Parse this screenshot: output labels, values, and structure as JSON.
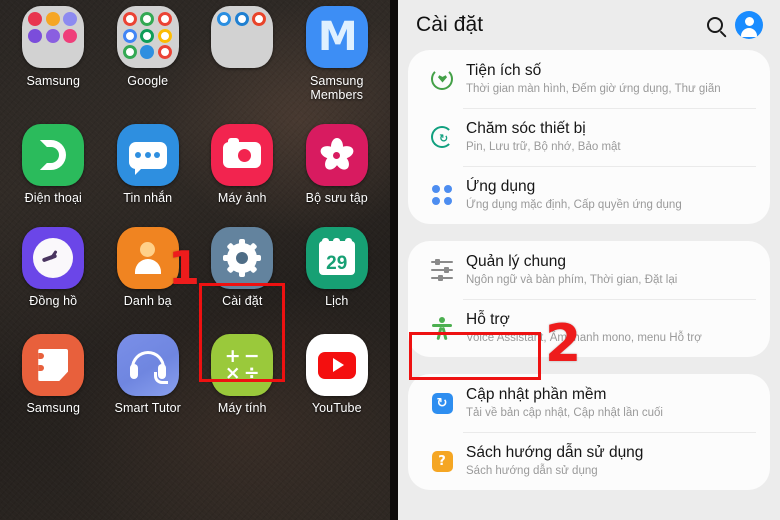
{
  "annotations": [
    {
      "label": "1",
      "name": "step-1-marker"
    },
    {
      "label": "2",
      "name": "step-2-marker"
    }
  ],
  "home": {
    "rows": [
      {
        "apps": [
          {
            "label": "Samsung",
            "icon": "samsung-folder-icon",
            "type": "folder",
            "tiles": [
              "#e8364f",
              "#f5a623",
              "#6c63e8",
              "#7b4ddb",
              "#8a5fe0",
              "#ef3f7a"
            ]
          },
          {
            "label": "Google",
            "icon": "google-folder-icon",
            "type": "folder",
            "tiles": [
              "#ffffff",
              "#ffffff",
              "#ffffff",
              "#ffffff",
              "#ffffff",
              "#ffffff",
              "#ffffff",
              "#ffffff",
              "#ffffff"
            ]
          },
          {
            "label": "",
            "icon": "microsoft-folder-icon",
            "type": "folder",
            "tiles": [
              "#2a8ee0",
              "#1f7fd0",
              "#e8442a"
            ]
          },
          {
            "label": "Samsung Members",
            "icon": "samsung-members-icon",
            "type": "app"
          }
        ]
      },
      {
        "apps": [
          {
            "label": "Điện thoại",
            "icon": "phone-icon",
            "type": "app"
          },
          {
            "label": "Tin nhắn",
            "icon": "messages-icon",
            "type": "app"
          },
          {
            "label": "Máy ảnh",
            "icon": "camera-icon",
            "type": "app"
          },
          {
            "label": "Bộ sưu tập",
            "icon": "gallery-icon",
            "type": "app"
          }
        ]
      },
      {
        "apps": [
          {
            "label": "Đồng hồ",
            "icon": "clock-icon",
            "type": "app"
          },
          {
            "label": "Danh bạ",
            "icon": "contacts-icon",
            "type": "app"
          },
          {
            "label": "Cài đặt",
            "icon": "settings-gear-icon",
            "type": "app",
            "highlighted": true
          },
          {
            "label": "Lịch",
            "icon": "calendar-icon",
            "type": "app",
            "badge": "29"
          }
        ]
      },
      {
        "apps": [
          {
            "label": "Samsung",
            "icon": "samsung-notes-icon",
            "type": "app"
          },
          {
            "label": "Smart Tutor",
            "icon": "smart-tutor-icon",
            "type": "app"
          },
          {
            "label": "Máy tính",
            "icon": "calculator-icon",
            "type": "app"
          },
          {
            "label": "YouTube",
            "icon": "youtube-icon",
            "type": "app"
          }
        ]
      }
    ],
    "calculator_symbols": [
      "+",
      "−",
      "×",
      "÷"
    ]
  },
  "settings": {
    "header": {
      "title": "Cài đặt",
      "search_icon": "search-icon",
      "account_icon": "account-avatar-icon"
    },
    "groups": [
      {
        "items": [
          {
            "title": "Tiện ích số",
            "subtitle": "Thời gian màn hình, Đếm giờ ứng dụng, Thư giãn",
            "icon": "digital-wellbeing-icon"
          },
          {
            "title": "Chăm sóc thiết bị",
            "subtitle": "Pin, Lưu trữ, Bộ nhớ, Bảo mật",
            "icon": "device-care-icon"
          },
          {
            "title": "Ứng dụng",
            "subtitle": "Ứng dụng mặc định, Cấp quyền ứng dụng",
            "icon": "apps-icon"
          }
        ]
      },
      {
        "items": [
          {
            "title": "Quản lý chung",
            "subtitle": "Ngôn ngữ và bàn phím, Thời gian, Đặt lại",
            "icon": "general-management-icon"
          },
          {
            "title": "Hỗ trợ",
            "subtitle": "Voice Assistant, Âm thanh mono, menu Hỗ trợ",
            "icon": "accessibility-icon",
            "highlighted": true
          }
        ]
      },
      {
        "items": [
          {
            "title": "Cập nhật phần mềm",
            "subtitle": "Tải về bản cập nhật, Cập nhật lần cuối",
            "icon": "software-update-icon",
            "glyph": "↻"
          },
          {
            "title": "Sách hướng dẫn sử dụng",
            "subtitle": "Sách hướng dẫn sử dụng",
            "icon": "user-manual-icon",
            "glyph": "?"
          }
        ]
      }
    ]
  }
}
